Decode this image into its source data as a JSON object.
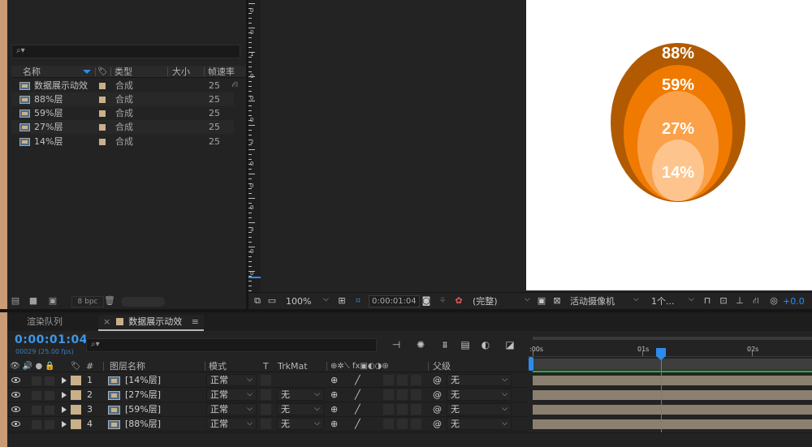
{
  "project": {
    "search_icon": "search-icon",
    "headers": {
      "name": "名称",
      "type": "类型",
      "size": "大小",
      "rate": "帧速率"
    },
    "items": [
      {
        "name": "数据展示动效",
        "type": "合成",
        "rate": "25"
      },
      {
        "name": "88%层",
        "type": "合成",
        "rate": "25"
      },
      {
        "name": "59%层",
        "type": "合成",
        "rate": "25"
      },
      {
        "name": "27%层",
        "type": "合成",
        "rate": "25"
      },
      {
        "name": "14%层",
        "type": "合成",
        "rate": "25"
      }
    ],
    "bpc_label": "8 bpc"
  },
  "chart_data": {
    "type": "other",
    "description_values": [
      "88%",
      "59%",
      "27%",
      "14%"
    ],
    "colors": {
      "ring_88": "#b15a02",
      "ring_59": "#f07a00",
      "ring_27": "#fba14a",
      "ring_14": "#fdc58d",
      "label": "#ffffff"
    }
  },
  "viewer": {
    "zoom": "100%",
    "timecode": "0:00:01:04",
    "resolution": "(完整)",
    "camera": "活动摄像机",
    "views": "1个...",
    "exposure": "+0.0"
  },
  "timeline": {
    "tabs": {
      "render_queue": "渲染队列",
      "comp": "数据展示动效",
      "close": "×",
      "menu": "≡"
    },
    "timecode": "0:00:01:04",
    "frame_info": "00029 (25.00 fps)",
    "headers": {
      "num": "#",
      "layer_name": "图层名称",
      "mode": "模式",
      "t": "T",
      "trkmat": "TrkMat",
      "parent": "父级"
    },
    "layers": [
      {
        "num": "1",
        "name": "[14%层]",
        "mode": "正常",
        "trkmat": "",
        "parent": "无"
      },
      {
        "num": "2",
        "name": "[27%层]",
        "mode": "正常",
        "trkmat": "无",
        "parent": "无"
      },
      {
        "num": "3",
        "name": "[59%层]",
        "mode": "正常",
        "trkmat": "无",
        "parent": "无"
      },
      {
        "num": "4",
        "name": "[88%层]",
        "mode": "正常",
        "trkmat": "无",
        "parent": "无"
      }
    ],
    "ruler_labels": [
      ":00s",
      "01s",
      "02s"
    ]
  },
  "ruler_numbers": [
    "0",
    "0",
    "1",
    "0",
    "0",
    "0",
    "2",
    "0",
    "0",
    "0",
    "3",
    "0",
    "0"
  ]
}
